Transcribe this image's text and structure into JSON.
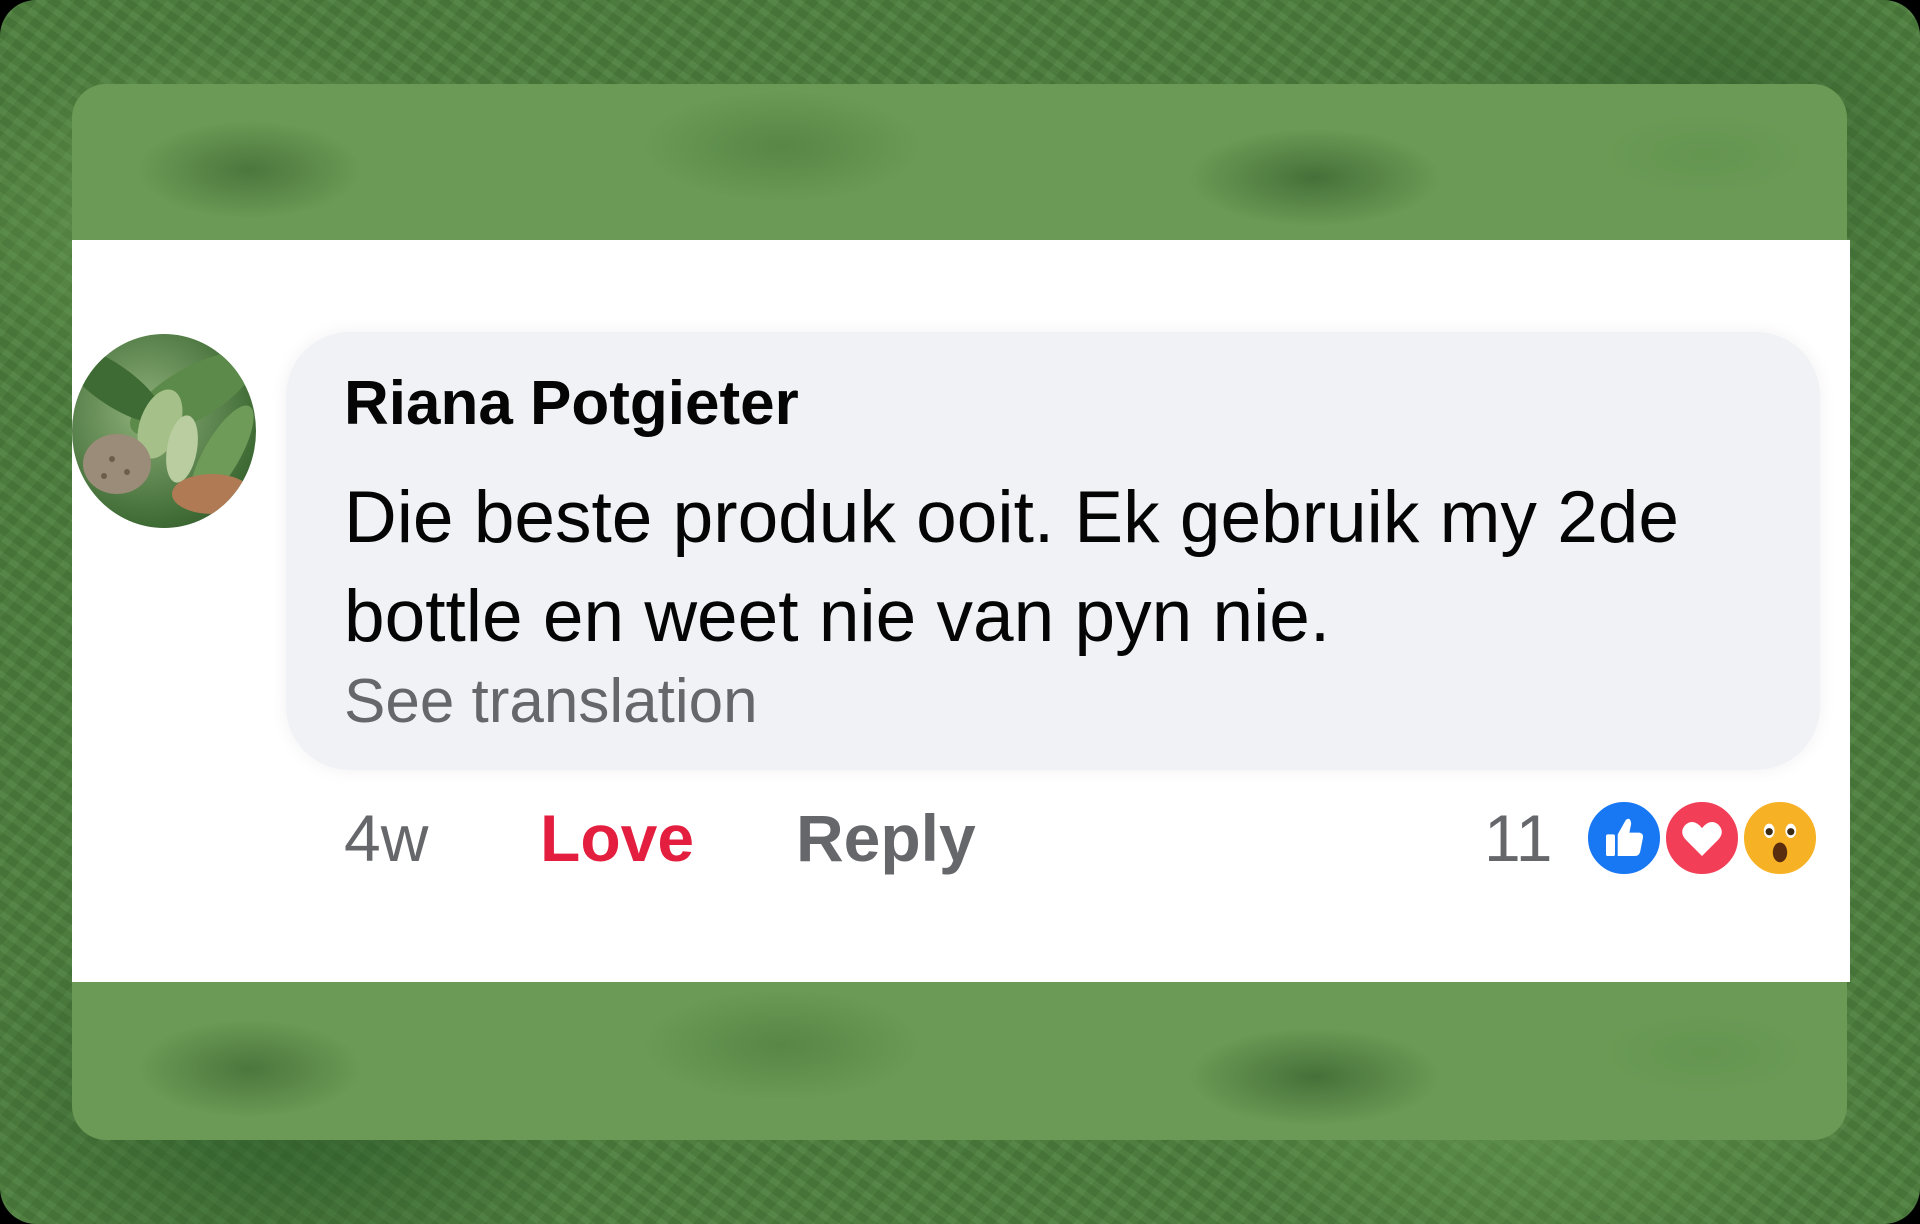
{
  "comment": {
    "author": "Riana Potgieter",
    "text": "Die beste produk ooit. Ek gebruik my 2de bottle en weet nie van pyn nie.",
    "see_translation": "See translation",
    "time": "4w",
    "love_label": "Love",
    "reply_label": "Reply",
    "reaction_count": "11",
    "reactions": [
      "like-icon",
      "love-icon",
      "wow-icon"
    ]
  },
  "colors": {
    "love": "#e41e3f",
    "muted": "#65676b",
    "bubble": "#f0f2f5",
    "like": "#1877f2",
    "heart": "#f33e58",
    "wow": "#f7b125",
    "background": "#4d7f3d"
  }
}
